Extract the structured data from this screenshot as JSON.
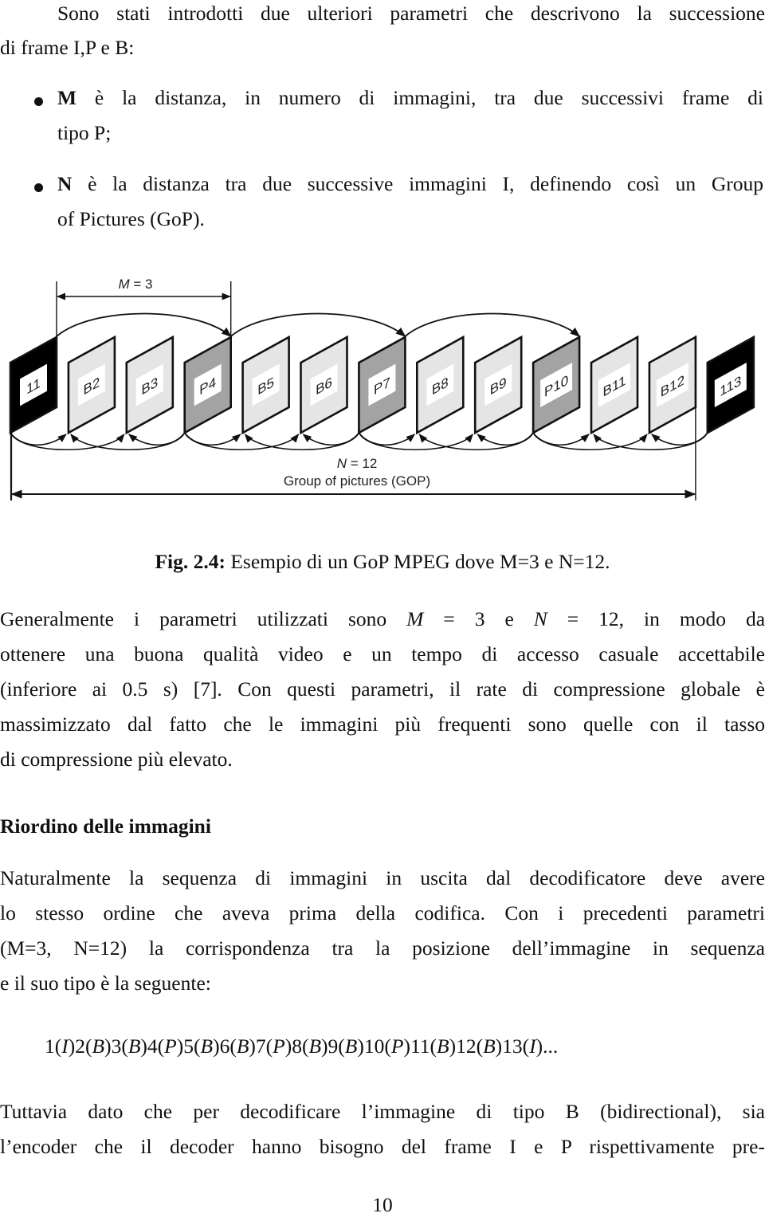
{
  "intro": {
    "line1": "Sono stati introdotti due ulteriori parametri che descrivono la successione",
    "line2": "di frame I,P e B:"
  },
  "bullets": [
    {
      "term": "M",
      "line1_rest": " è la distanza, in numero di immagini, tra due successivi frame di",
      "line2": "tipo P;"
    },
    {
      "term": "N",
      "line1_rest": " è la distanza tra due successive immagini I, definendo così un Group",
      "line2": "of Pictures (GoP)."
    }
  ],
  "figure": {
    "m_label_var": "M",
    "m_label_rest": " = 3",
    "n_label_var": "N",
    "n_label_rest": " = 12",
    "gop_label": "Group of pictures (GOP)",
    "frames": [
      {
        "label": "I1",
        "display": "11",
        "type": "I"
      },
      {
        "label": "B2",
        "display": "B2",
        "type": "B"
      },
      {
        "label": "B3",
        "display": "B3",
        "type": "B"
      },
      {
        "label": "P4",
        "display": "P4",
        "type": "P"
      },
      {
        "label": "B5",
        "display": "B5",
        "type": "B"
      },
      {
        "label": "B6",
        "display": "B6",
        "type": "B"
      },
      {
        "label": "P7",
        "display": "P7",
        "type": "P"
      },
      {
        "label": "B8",
        "display": "B8",
        "type": "B"
      },
      {
        "label": "B9",
        "display": "B9",
        "type": "B"
      },
      {
        "label": "P10",
        "display": "P10",
        "type": "P"
      },
      {
        "label": "B11",
        "display": "B11",
        "type": "B"
      },
      {
        "label": "B12",
        "display": "B12",
        "type": "B"
      },
      {
        "label": "I13",
        "display": "113",
        "type": "I"
      }
    ],
    "colors": {
      "I": "#000000",
      "P": "#a3a3a3",
      "B": "#e5e5e5",
      "label_bg": "#ffffff",
      "stroke": "#111111"
    },
    "forward_predictions": [
      [
        0,
        3
      ],
      [
        3,
        6
      ],
      [
        6,
        9
      ]
    ],
    "bidirectional_groups": [
      {
        "past": 0,
        "future": 3,
        "b": [
          1,
          2
        ]
      },
      {
        "past": 3,
        "future": 6,
        "b": [
          4,
          5
        ]
      },
      {
        "past": 6,
        "future": 9,
        "b": [
          7,
          8
        ]
      },
      {
        "past": 9,
        "future": 12,
        "b": [
          10,
          11
        ]
      }
    ],
    "m_span": [
      0,
      3
    ],
    "gop_span": [
      0,
      12
    ]
  },
  "caption": {
    "label": "Fig. 2.4:",
    "text": " Esempio di un GoP MPEG dove M=3 e N=12."
  },
  "para2": {
    "line1_a": "Generalmente i parametri utilizzati sono ",
    "line1_m": "M",
    "line1_b": " = 3 e ",
    "line1_n": "N",
    "line1_c": " = 12, in modo da",
    "line2": "ottenere una buona qualità video e un tempo di accesso casuale accettabile",
    "line3": "(inferiore ai 0.5 s) [7].  Con questi parametri, il rate di compressione globale è",
    "line4": "massimizzato dal fatto che le immagini più frequenti sono quelle con il tasso",
    "line5": "di compressione più elevato."
  },
  "section": {
    "title": "Riordino delle immagini"
  },
  "para3": {
    "line1": "Naturalmente la sequenza di immagini in uscita dal decodificatore deve avere",
    "line2": "lo stesso ordine che aveva prima della codifica.  Con i precedenti parametri",
    "line3": "(M=3, N=12) la corrispondenza tra la posizione dell’immagine in sequenza",
    "line4": "e il suo tipo è la seguente:"
  },
  "sequence": [
    {
      "n": "1",
      "t": "I"
    },
    {
      "n": "2",
      "t": "B"
    },
    {
      "n": "3",
      "t": "B"
    },
    {
      "n": "4",
      "t": "P"
    },
    {
      "n": "5",
      "t": "B"
    },
    {
      "n": "6",
      "t": "B"
    },
    {
      "n": "7",
      "t": "P"
    },
    {
      "n": "8",
      "t": "B"
    },
    {
      "n": "9",
      "t": "B"
    },
    {
      "n": "10",
      "t": "P"
    },
    {
      "n": "11",
      "t": "B"
    },
    {
      "n": "12",
      "t": "B"
    },
    {
      "n": "13",
      "t": "I"
    }
  ],
  "sequence_tail": "...",
  "para4": {
    "line1": "Tuttavia dato che per decodificare l’immagine di tipo B (bidirectional), sia",
    "line2": "l’encoder che il decoder hanno bisogno del frame I e P rispettivamente pre-"
  },
  "page_number": "10"
}
